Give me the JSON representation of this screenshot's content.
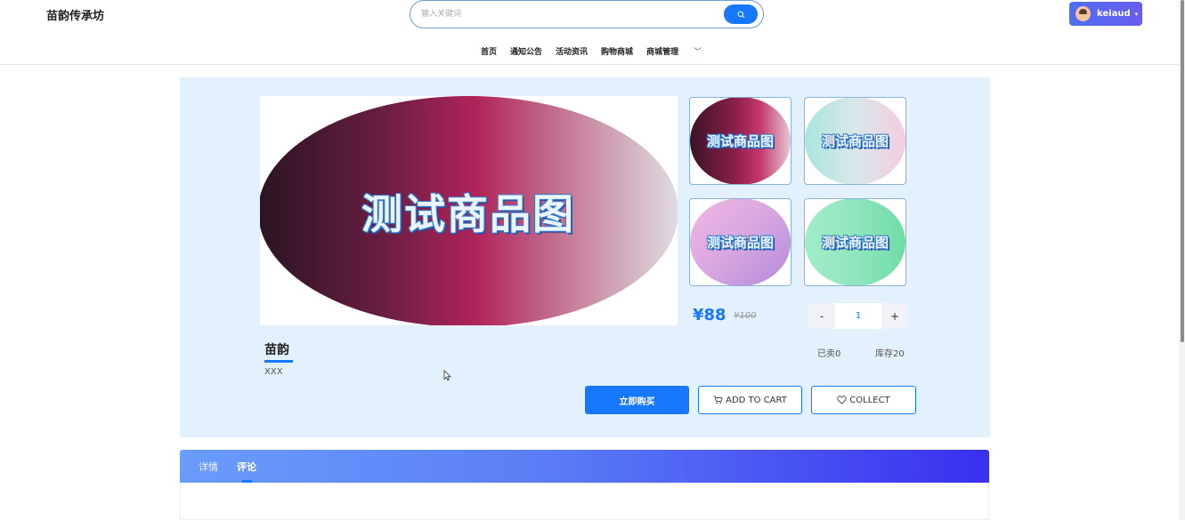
{
  "header": {
    "site_name": "苗韵传承坊",
    "search_placeholder": "输入关键词",
    "search_icon": "search-icon",
    "user_name": "keiaud",
    "nav": [
      {
        "label": "首页"
      },
      {
        "label": "通知公告"
      },
      {
        "label": "活动资讯"
      },
      {
        "label": "购物商城"
      },
      {
        "label": "商城管理"
      }
    ]
  },
  "product": {
    "image_text": "测试商品图",
    "thumbnails": [
      {
        "text": "测试商品图"
      },
      {
        "text": "测试商品图"
      },
      {
        "text": "测试商品图"
      },
      {
        "text": "测试商品图"
      }
    ],
    "price": "¥88",
    "original_price": "¥100",
    "quantity": {
      "minus": "-",
      "value": "1",
      "plus": "+"
    },
    "name": "苗韵",
    "description": "XXX",
    "sold": "已卖0",
    "stock": "库存20",
    "buttons": {
      "buy": "立即购买",
      "add_to_cart": "ADD TO CART",
      "collect": "COLLECT"
    }
  },
  "tabs": [
    {
      "label": "详情"
    },
    {
      "label": "评论",
      "active": true
    }
  ],
  "colors": {
    "accent": "#1677ff",
    "panel_bg": "#e3f0fd"
  }
}
